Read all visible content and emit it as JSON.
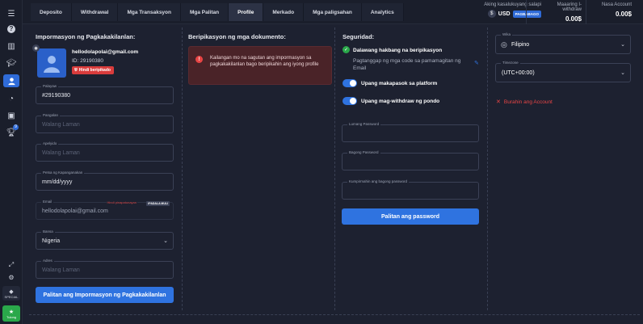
{
  "sidebar": {
    "icons": [
      "menu-icon",
      "help-icon",
      "chart-icon",
      "education-icon",
      "profile-icon",
      "pie-icon",
      "trade-icon",
      "trophy-icon"
    ],
    "trophy_badge": "9",
    "special_label": "SPECIAL",
    "help_label": "Tulong"
  },
  "topbar": {
    "tabs": [
      "Deposito",
      "Withdrawal",
      "Mga Transaksyon",
      "Mga Palitan",
      "Profile",
      "Merkado",
      "Mga paligsahan",
      "Analytics"
    ],
    "active_tab": "Profile",
    "account_currency_label": "Aking kasalukuyang salapi",
    "currency": "USD",
    "currency_button": "PAGBABAGO",
    "withdraw_label": "Maaaring I-withdraw",
    "withdraw_value": "0.00$",
    "account_label": "Nasa Account",
    "account_value": "0.00$"
  },
  "personal": {
    "title": "Impormasyon ng Pagkakakilanlan:",
    "email": "hellodolapolai@gmail.com",
    "id": "ID: 29190380",
    "status": "Hindi beripikado",
    "fields": {
      "palayaw_label": "Palayaw",
      "palayaw_value": "#29190380",
      "pangalan_label": "Pangalan",
      "apelyido_label": "Apelyido",
      "birth_label": "Petsa ng Kapanganakan",
      "birth_value": "mm/dd/yyyy",
      "email_label": "Email",
      "email_note": "Hindi pinapatunayan",
      "email_button": "IPADALA MULI",
      "email_value": "hellodolapolai@gmail.com",
      "bansa_label": "Bansa",
      "bansa_value": "Nigeria",
      "adres_label": "Adres",
      "empty_placeholder": "Walang Laman"
    },
    "save_button": "Palitan ang Impormasyon ng Pagkakakilanlan"
  },
  "verification": {
    "title": "Beripikasyon ng mga dokumento:",
    "alert": "Kailangan mo na sagutan ang impormasyon sa pagkakakilanlan bago beripikahin ang iyong profile"
  },
  "security": {
    "title": "Seguridad:",
    "two_step_title": "Dalawang hakbang na beripikasyon",
    "two_step_desc": "Pagtanggap ng mga code sa pamamagitan ng Email",
    "toggle_login": "Upang makapasok sa platform",
    "toggle_withdraw": "Upang mag-withdraw ng pondo",
    "current_password": "Lumang Password",
    "new_password": "Bagong Password",
    "confirm_password": "Kumpirmahin ang bagong password",
    "change_password_button": "Palitan ang password"
  },
  "settings": {
    "language_label": "Wika",
    "language_value": "Filipino",
    "timezone_label": "Timezone",
    "timezone_value": "(UTC+00:00)",
    "delete_account": "Burahin ang Account"
  }
}
